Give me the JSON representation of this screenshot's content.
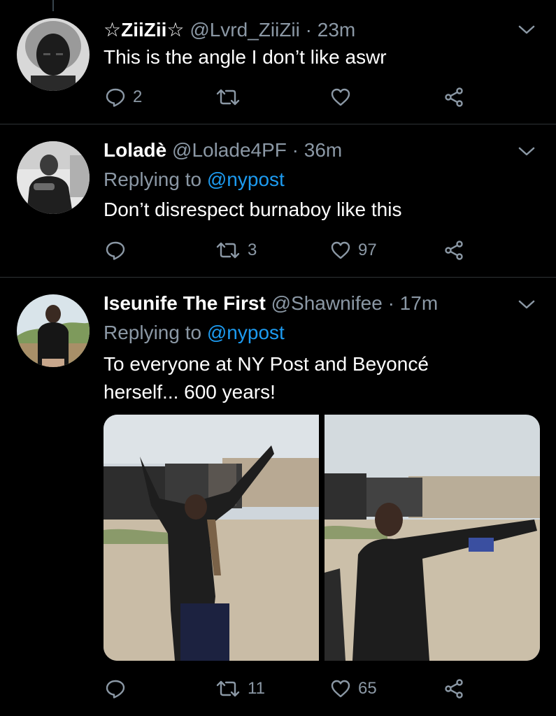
{
  "tweets": [
    {
      "display_name": "☆ZiiZii☆",
      "handle": "@Lvrd_ZiiZii",
      "time": "· 23m",
      "reply_prefix": "",
      "reply_to": "",
      "text": "This is the angle I don’t like aswr",
      "reply_count": "2",
      "retweet_count": "",
      "like_count": ""
    },
    {
      "display_name": "Loladè",
      "handle": "@Lolade4PF",
      "time": "· 36m",
      "reply_prefix": "Replying to",
      "reply_to": "@nypost",
      "text": "Don’t disrespect burnaboy like this",
      "reply_count": "",
      "retweet_count": "3",
      "like_count": "97"
    },
    {
      "display_name": "Iseunife The First",
      "handle": "@Shawnifee",
      "time": "· 17m",
      "reply_prefix": "Replying to",
      "reply_to": "@nypost",
      "text": "To everyone at NY Post and Beyoncé herself... 600 years!",
      "reply_count": "",
      "retweet_count": "11",
      "like_count": "65"
    }
  ],
  "icons": {
    "reply": "reply-icon",
    "retweet": "retweet-icon",
    "like": "heart-icon",
    "share": "share-icon",
    "more": "chevron-down-icon"
  },
  "colors": {
    "background": "#000000",
    "secondary_text": "#8b98a5",
    "mention": "#1d9bf0",
    "divider": "#2f3336"
  }
}
